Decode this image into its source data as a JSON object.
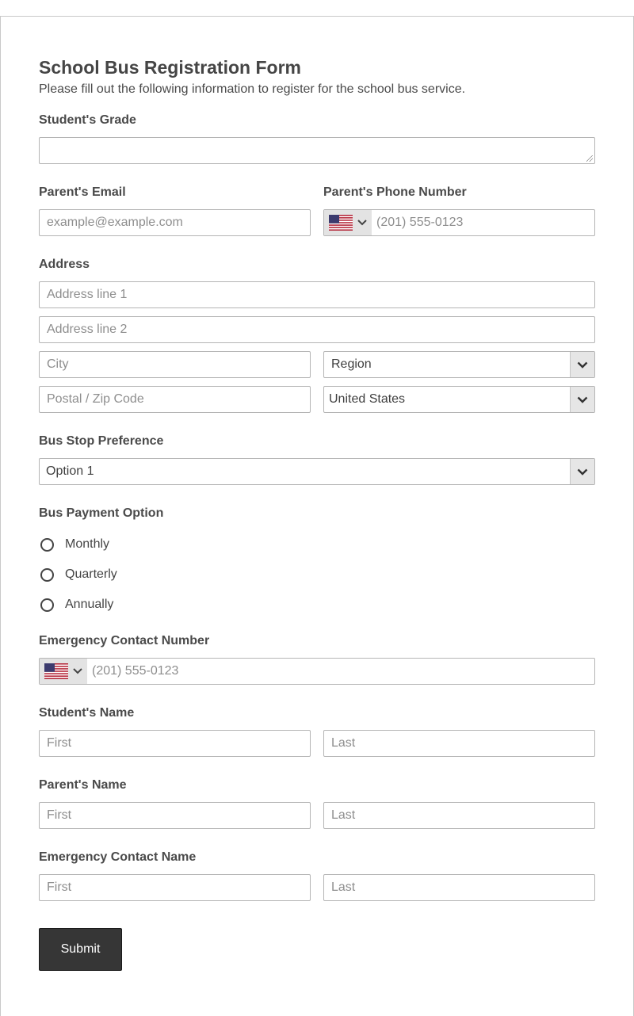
{
  "form": {
    "title": "School Bus Registration Form",
    "subtitle": "Please fill out the following information to register for the school bus service."
  },
  "student_grade": {
    "label": "Student's Grade",
    "value": ""
  },
  "parent_email": {
    "label": "Parent's Email",
    "placeholder": "example@example.com"
  },
  "parent_phone": {
    "label": "Parent's Phone Number",
    "placeholder": "(201) 555-0123",
    "country_flag": "us-flag-icon"
  },
  "address": {
    "label": "Address",
    "line1_placeholder": "Address line 1",
    "line2_placeholder": "Address line 2",
    "city_placeholder": "City",
    "region_value": "Region",
    "postal_placeholder": "Postal / Zip Code",
    "country_value": "United States"
  },
  "bus_stop": {
    "label": "Bus Stop Preference",
    "value": "Option 1"
  },
  "payment": {
    "label": "Bus Payment Option",
    "options": [
      "Monthly",
      "Quarterly",
      "Annually"
    ]
  },
  "emergency_phone": {
    "label": "Emergency Contact Number",
    "placeholder": "(201) 555-0123",
    "country_flag": "us-flag-icon"
  },
  "student_name": {
    "label": "Student's Name",
    "first_placeholder": "First",
    "last_placeholder": "Last"
  },
  "parent_name": {
    "label": "Parent's Name",
    "first_placeholder": "First",
    "last_placeholder": "Last"
  },
  "emergency_name": {
    "label": "Emergency Contact Name",
    "first_placeholder": "First",
    "last_placeholder": "Last"
  },
  "submit_label": "Submit",
  "colors": {
    "button_bg": "#363636",
    "border": "#b5b5b5",
    "label_text": "#4a4a4a",
    "placeholder": "#8e8e8e"
  }
}
